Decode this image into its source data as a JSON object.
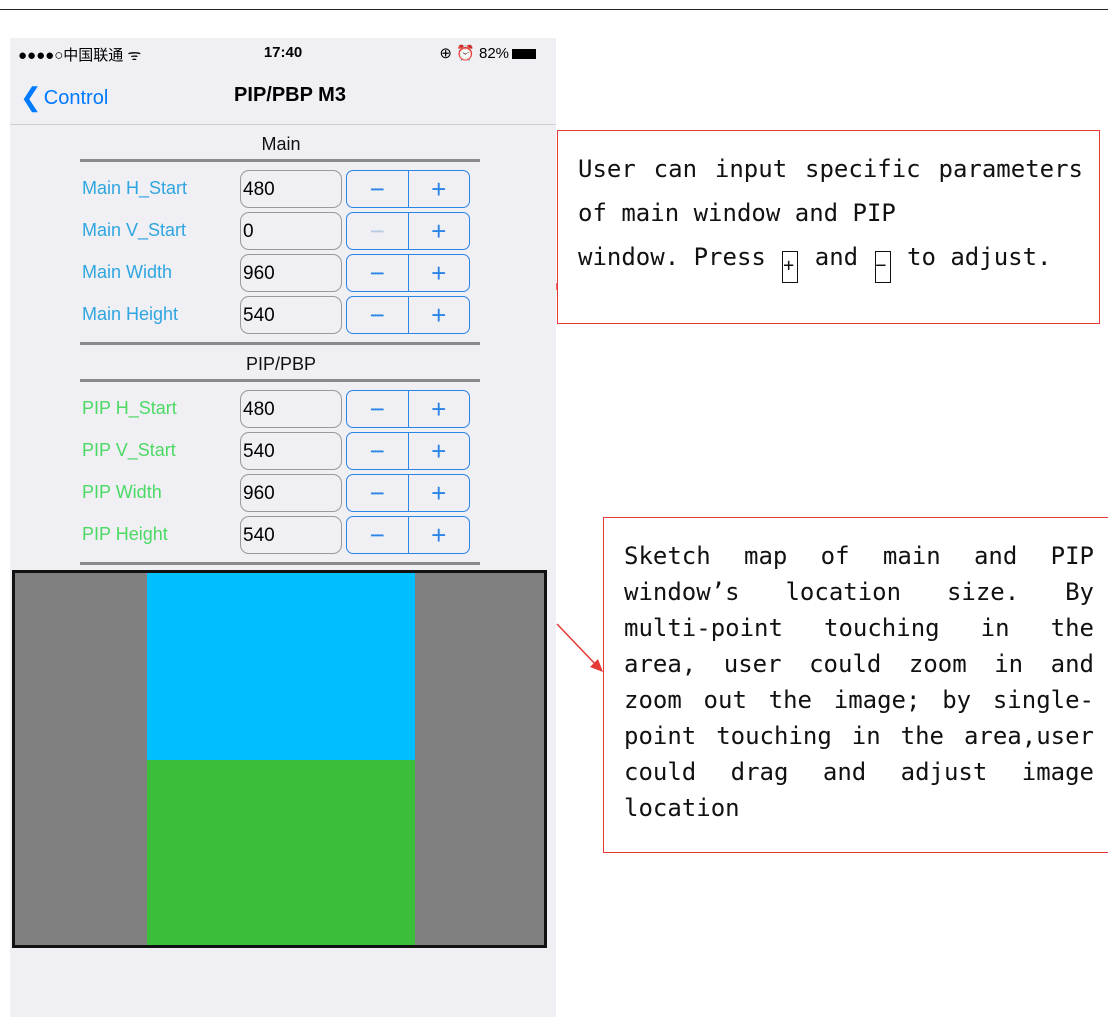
{
  "status_bar": {
    "carrier": "●●●●○中国联通 ᯤ",
    "time": "17:40",
    "right": "⊕ ⏰ 82%"
  },
  "nav": {
    "back_label": "Control",
    "title": "PIP/PBP M3"
  },
  "main_section": {
    "title": "Main",
    "rows": [
      {
        "label": "Main H_Start",
        "value": "480",
        "minus_enabled": true
      },
      {
        "label": "Main V_Start",
        "value": "0",
        "minus_enabled": false
      },
      {
        "label": "Main Width",
        "value": "960",
        "minus_enabled": true
      },
      {
        "label": "Main Height",
        "value": "540",
        "minus_enabled": true
      }
    ]
  },
  "pip_section": {
    "title": "PIP/PBP",
    "rows": [
      {
        "label": "PIP H_Start",
        "value": "480",
        "minus_enabled": true
      },
      {
        "label": "PIP V_Start",
        "value": "540",
        "minus_enabled": true
      },
      {
        "label": "PIP Width",
        "value": "960",
        "minus_enabled": true
      },
      {
        "label": "PIP Height",
        "value": "540",
        "minus_enabled": true
      }
    ]
  },
  "stepper": {
    "minus": "−",
    "plus": "+"
  },
  "colors": {
    "main_window": "#00bfff",
    "pip_window": "#3bbf3b",
    "canvas": "#808080",
    "accent": "#2b85e6",
    "callout_border": "#e53935"
  },
  "callouts": {
    "first": {
      "line1": "User can input specific parameters of main window and PIP",
      "part_a": "window. Press ",
      "plus": "+",
      "part_b": " and ",
      "minus": "−",
      "part_c": " to adjust."
    },
    "second": "Sketch map of main and PIP window’s location size. By multi-point touching in the area, user could zoom in and zoom out the image; by single-point touching in the area,user could drag and adjust image location"
  }
}
